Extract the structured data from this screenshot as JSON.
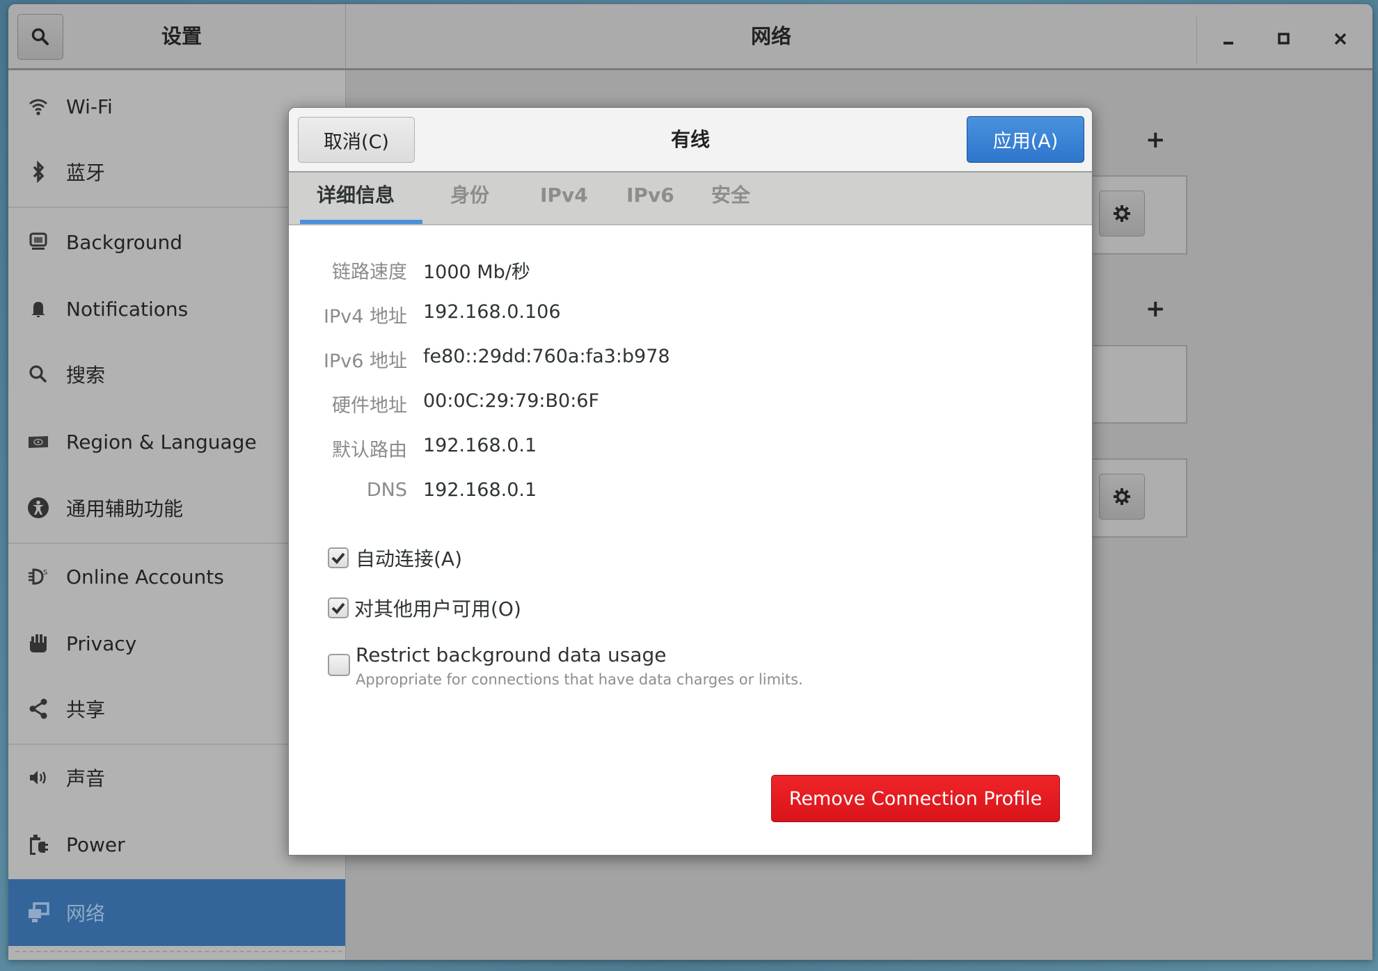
{
  "window": {
    "sidebar_title": "设置",
    "panel_title": "网络",
    "controls": {
      "minimize": "–",
      "maximize": "□",
      "close": "✕"
    }
  },
  "sidebar": {
    "items": [
      {
        "label": "Wi-Fi",
        "icon": "wifi-icon"
      },
      {
        "label": "蓝牙",
        "icon": "bluetooth-icon"
      },
      {
        "label": "Background",
        "icon": "background-icon"
      },
      {
        "label": "Notifications",
        "icon": "bell-icon"
      },
      {
        "label": "搜索",
        "icon": "search-icon"
      },
      {
        "label": "Region & Language",
        "icon": "region-icon"
      },
      {
        "label": "通用辅助功能",
        "icon": "accessibility-icon"
      },
      {
        "label": "Online Accounts",
        "icon": "online-accounts-icon"
      },
      {
        "label": "Privacy",
        "icon": "hand-icon"
      },
      {
        "label": "共享",
        "icon": "share-icon"
      },
      {
        "label": "声音",
        "icon": "speaker-icon"
      },
      {
        "label": "Power",
        "icon": "power-icon"
      },
      {
        "label": "网络",
        "icon": "network-icon",
        "selected": true
      }
    ]
  },
  "content": {
    "plus_label": "+",
    "gear_label": "⚙"
  },
  "dialog": {
    "title": "有线",
    "cancel_label": "取消(C)",
    "apply_label": "应用(A)",
    "tabs": [
      {
        "label": "详细信息",
        "active": true
      },
      {
        "label": "身份"
      },
      {
        "label": "IPv4"
      },
      {
        "label": "IPv6"
      },
      {
        "label": "安全"
      }
    ],
    "details": [
      {
        "key": "链路速度",
        "value": "1000 Mb/秒"
      },
      {
        "key": "IPv4 地址",
        "value": "192.168.0.106"
      },
      {
        "key": "IPv6 地址",
        "value": "fe80::29dd:760a:fa3:b978"
      },
      {
        "key": "硬件地址",
        "value": "00:0C:29:79:B0:6F"
      },
      {
        "key": "默认路由",
        "value": "192.168.0.1"
      },
      {
        "key": "DNS",
        "value": "192.168.0.1"
      }
    ],
    "options": [
      {
        "label": "自动连接(A)",
        "checked": true
      },
      {
        "label": "对其他用户可用(O)",
        "checked": true
      },
      {
        "label": "Restrict background data usage",
        "sublabel": "Appropriate for connections that have data charges or limits.",
        "checked": false
      }
    ],
    "remove_label": "Remove Connection Profile"
  },
  "colors": {
    "accent": "#4a90d9",
    "selected_row": "#33659a",
    "apply": "#2d76cc",
    "destructive": "#e0161c"
  }
}
